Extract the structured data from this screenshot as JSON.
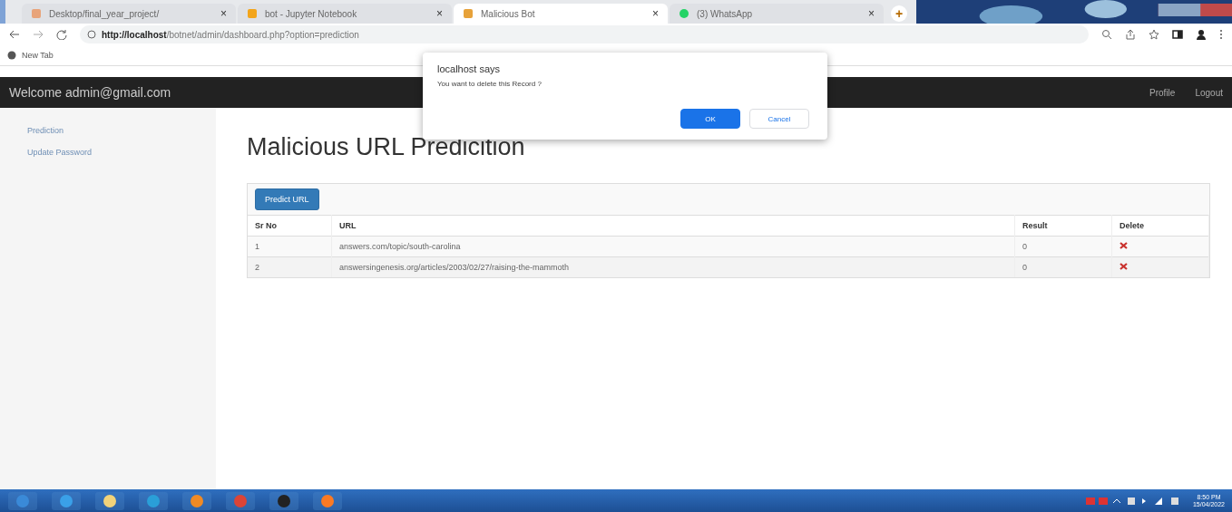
{
  "browser": {
    "tabs": [
      {
        "title": "Desktop/final_year_project/",
        "close": "×",
        "selected": false,
        "kind": "folder"
      },
      {
        "title": "bot - Jupyter Notebook",
        "close": "×",
        "selected": false,
        "kind": "jupyter"
      },
      {
        "title": "Malicious Bot",
        "close": "×",
        "selected": true,
        "kind": "site"
      },
      {
        "title": "(3) WhatsApp",
        "close": "×",
        "selected": false,
        "kind": "chat"
      }
    ],
    "new_tab": "+",
    "address": {
      "host": "http://localhost",
      "path": "/botnet/admin/dashboard.php?option=prediction"
    },
    "bookmarks": [
      "New Tab"
    ]
  },
  "navbar": {
    "brand": "Welcome admin@gmail.com",
    "links": [
      "Profile",
      "Logout"
    ]
  },
  "sidebar": {
    "items": [
      {
        "label": "Prediction",
        "selected": false
      },
      {
        "label": "Update Password",
        "selected": false
      }
    ]
  },
  "page": {
    "title": "Malicious URL Predicition",
    "button": "Predict URL",
    "table": {
      "columns": [
        "Sr No",
        "URL",
        "Result",
        "Delete"
      ],
      "rows": [
        {
          "sr": "1",
          "url": "answers.com/topic/south-carolina",
          "result": "0"
        },
        {
          "sr": "2",
          "url": "answersingenesis.org/articles/2003/02/27/raising-the-mammoth",
          "result": "0"
        }
      ]
    }
  },
  "dialog": {
    "title": "localhost says",
    "message": "You want to delete this Record ?",
    "buttons": [
      {
        "label": "OK",
        "primary": true
      },
      {
        "label": "Cancel",
        "primary": false
      }
    ]
  },
  "taskbar": {
    "apps": [
      {
        "kind": "start"
      },
      {
        "kind": "ie"
      },
      {
        "kind": "folder"
      },
      {
        "kind": "edge"
      },
      {
        "kind": "media"
      },
      {
        "kind": "chrome"
      },
      {
        "kind": "terminal"
      },
      {
        "kind": "xampp"
      }
    ],
    "time": "8:50 PM",
    "date": "15/04/2022"
  }
}
